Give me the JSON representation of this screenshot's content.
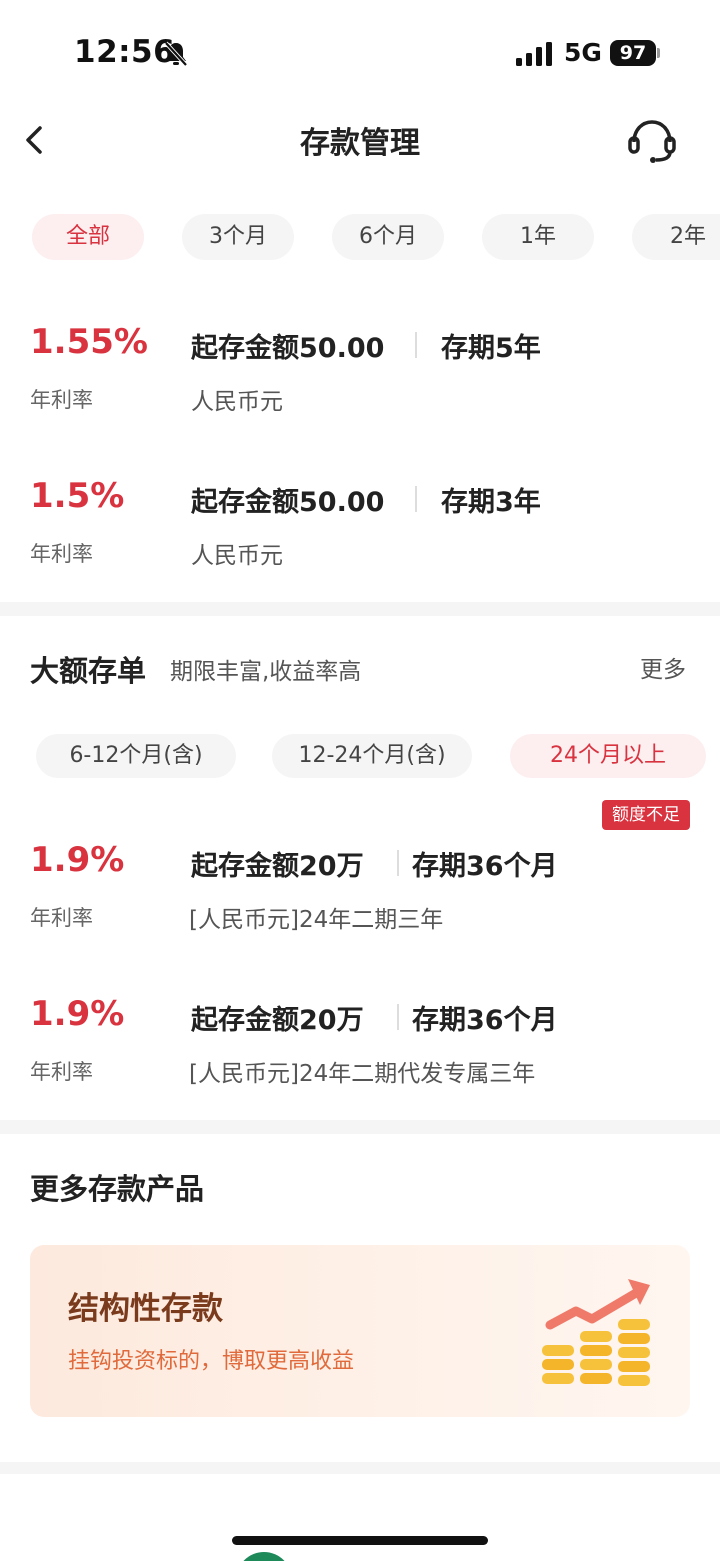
{
  "status_bar": {
    "time": "12:56",
    "network": "5G",
    "battery": "97"
  },
  "nav": {
    "title": "存款管理"
  },
  "term_tabs": [
    {
      "label": "全部",
      "active": true
    },
    {
      "label": "3个月",
      "active": false
    },
    {
      "label": "6个月",
      "active": false
    },
    {
      "label": "1年",
      "active": false
    },
    {
      "label": "2年",
      "active": false
    }
  ],
  "deposits": [
    {
      "rate": "1.55%",
      "rate_label": "年利率",
      "min_amount": "起存金额50.00",
      "term": "存期5年",
      "currency": "人民币元"
    },
    {
      "rate": "1.5%",
      "rate_label": "年利率",
      "min_amount": "起存金额50.00",
      "term": "存期3年",
      "currency": "人民币元"
    }
  ],
  "large_cd": {
    "title": "大额存单",
    "subtitle": "期限丰富,收益率高",
    "more": "更多",
    "tabs": [
      {
        "label": "6-12个月(含)",
        "active": false
      },
      {
        "label": "12-24个月(含)",
        "active": false
      },
      {
        "label": "24个月以上",
        "active": true
      }
    ],
    "badge": "额度不足",
    "items": [
      {
        "rate": "1.9%",
        "rate_label": "年利率",
        "min_amount": "起存金额20万",
        "term": "存期36个月",
        "desc": "[人民币元]24年二期三年"
      },
      {
        "rate": "1.9%",
        "rate_label": "年利率",
        "min_amount": "起存金额20万",
        "term": "存期36个月",
        "desc": "[人民币元]24年二期代发专属三年"
      }
    ]
  },
  "more_products": {
    "title": "更多存款产品",
    "card": {
      "name": "结构性存款",
      "desc": "挂钩投资标的，博取更高收益",
      "icon": "coins-chart-icon"
    }
  },
  "colors": {
    "accent": "#d8333f",
    "pill_bg": "#f5f5f5",
    "active_pill_bg": "#fdeef0"
  }
}
